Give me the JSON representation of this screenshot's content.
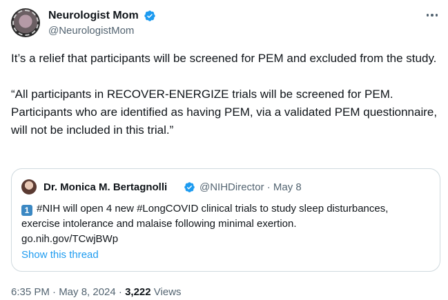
{
  "author": {
    "name": "Neurologist Mom",
    "handle": "@NeurologistMom"
  },
  "tweet": {
    "paragraph1": "It’s a relief that participants will be screened for PEM and excluded from the study.",
    "paragraph2": "“All participants in RECOVER-ENERGIZE trials will be screened for PEM. Participants who are identified as having PEM, via a validated PEM questionnaire, will not be included in this trial.”"
  },
  "quote": {
    "author_name": "Dr. Monica M. Bertagnolli",
    "handle_date": "@NIHDirector · May 8",
    "keycap": "1",
    "text": "#NIH will open 4 new #LongCOVID clinical trials to study sleep disturbances, exercise intolerance and malaise following minimal exertion.",
    "link": "go.nih.gov/TCwjBWp",
    "show_thread": "Show this thread"
  },
  "footer": {
    "timestamp": "6:35 PM · May 8, 2024 · ",
    "views_count": "3,222",
    "views_label": " Views"
  },
  "icons": {
    "verified": "verified-badge-icon",
    "more": "more-options-icon"
  },
  "colors": {
    "verified": "#1d9bf0",
    "link": "#1d9bf0",
    "secondary_text": "#536471"
  }
}
